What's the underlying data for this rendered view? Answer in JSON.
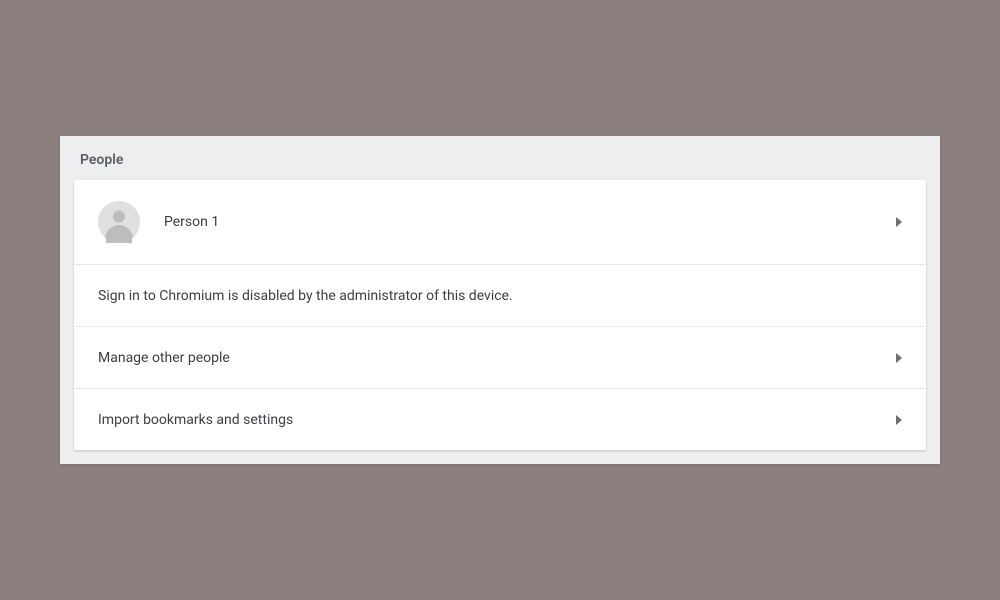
{
  "section": {
    "title": "People"
  },
  "rows": {
    "profile": {
      "name": "Person 1"
    },
    "signin_notice": "Sign in to Chromium is disabled by the administrator of this device.",
    "manage_label": "Manage other people",
    "import_label": "Import bookmarks and settings"
  }
}
